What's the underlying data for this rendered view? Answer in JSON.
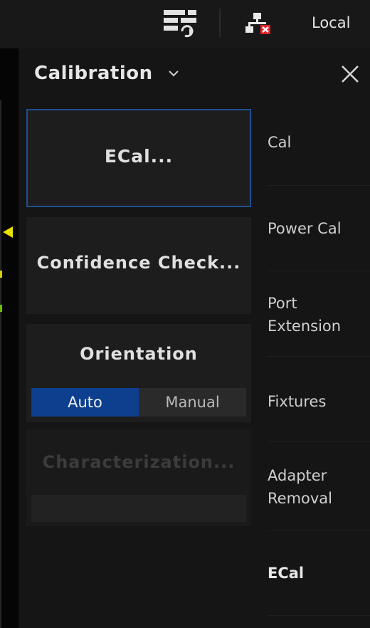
{
  "topbar": {
    "icons": [
      "display-layout-icon",
      "lan-disconnected-icon"
    ],
    "local_label": "Local"
  },
  "panel": {
    "title": "Calibration",
    "close_icon": "close-icon",
    "actions": {
      "ecal": "ECal...",
      "confidence_check": "Confidence Check...",
      "orientation": {
        "label": "Orientation",
        "options": [
          "Auto",
          "Manual"
        ],
        "selected": "Auto"
      },
      "characterization": "Characterization..."
    },
    "nav": [
      {
        "label": "Cal"
      },
      {
        "label": "Power Cal"
      },
      {
        "label": "Port",
        "label2": "Extension"
      },
      {
        "label": "Fixtures"
      },
      {
        "label": "Adapter",
        "label2": "Removal"
      },
      {
        "label": "ECal"
      }
    ]
  },
  "colors": {
    "accent": "#0d3f8e",
    "selected_border": "#204e8e",
    "marker": "#e8e200",
    "alert": "#e0202a"
  }
}
